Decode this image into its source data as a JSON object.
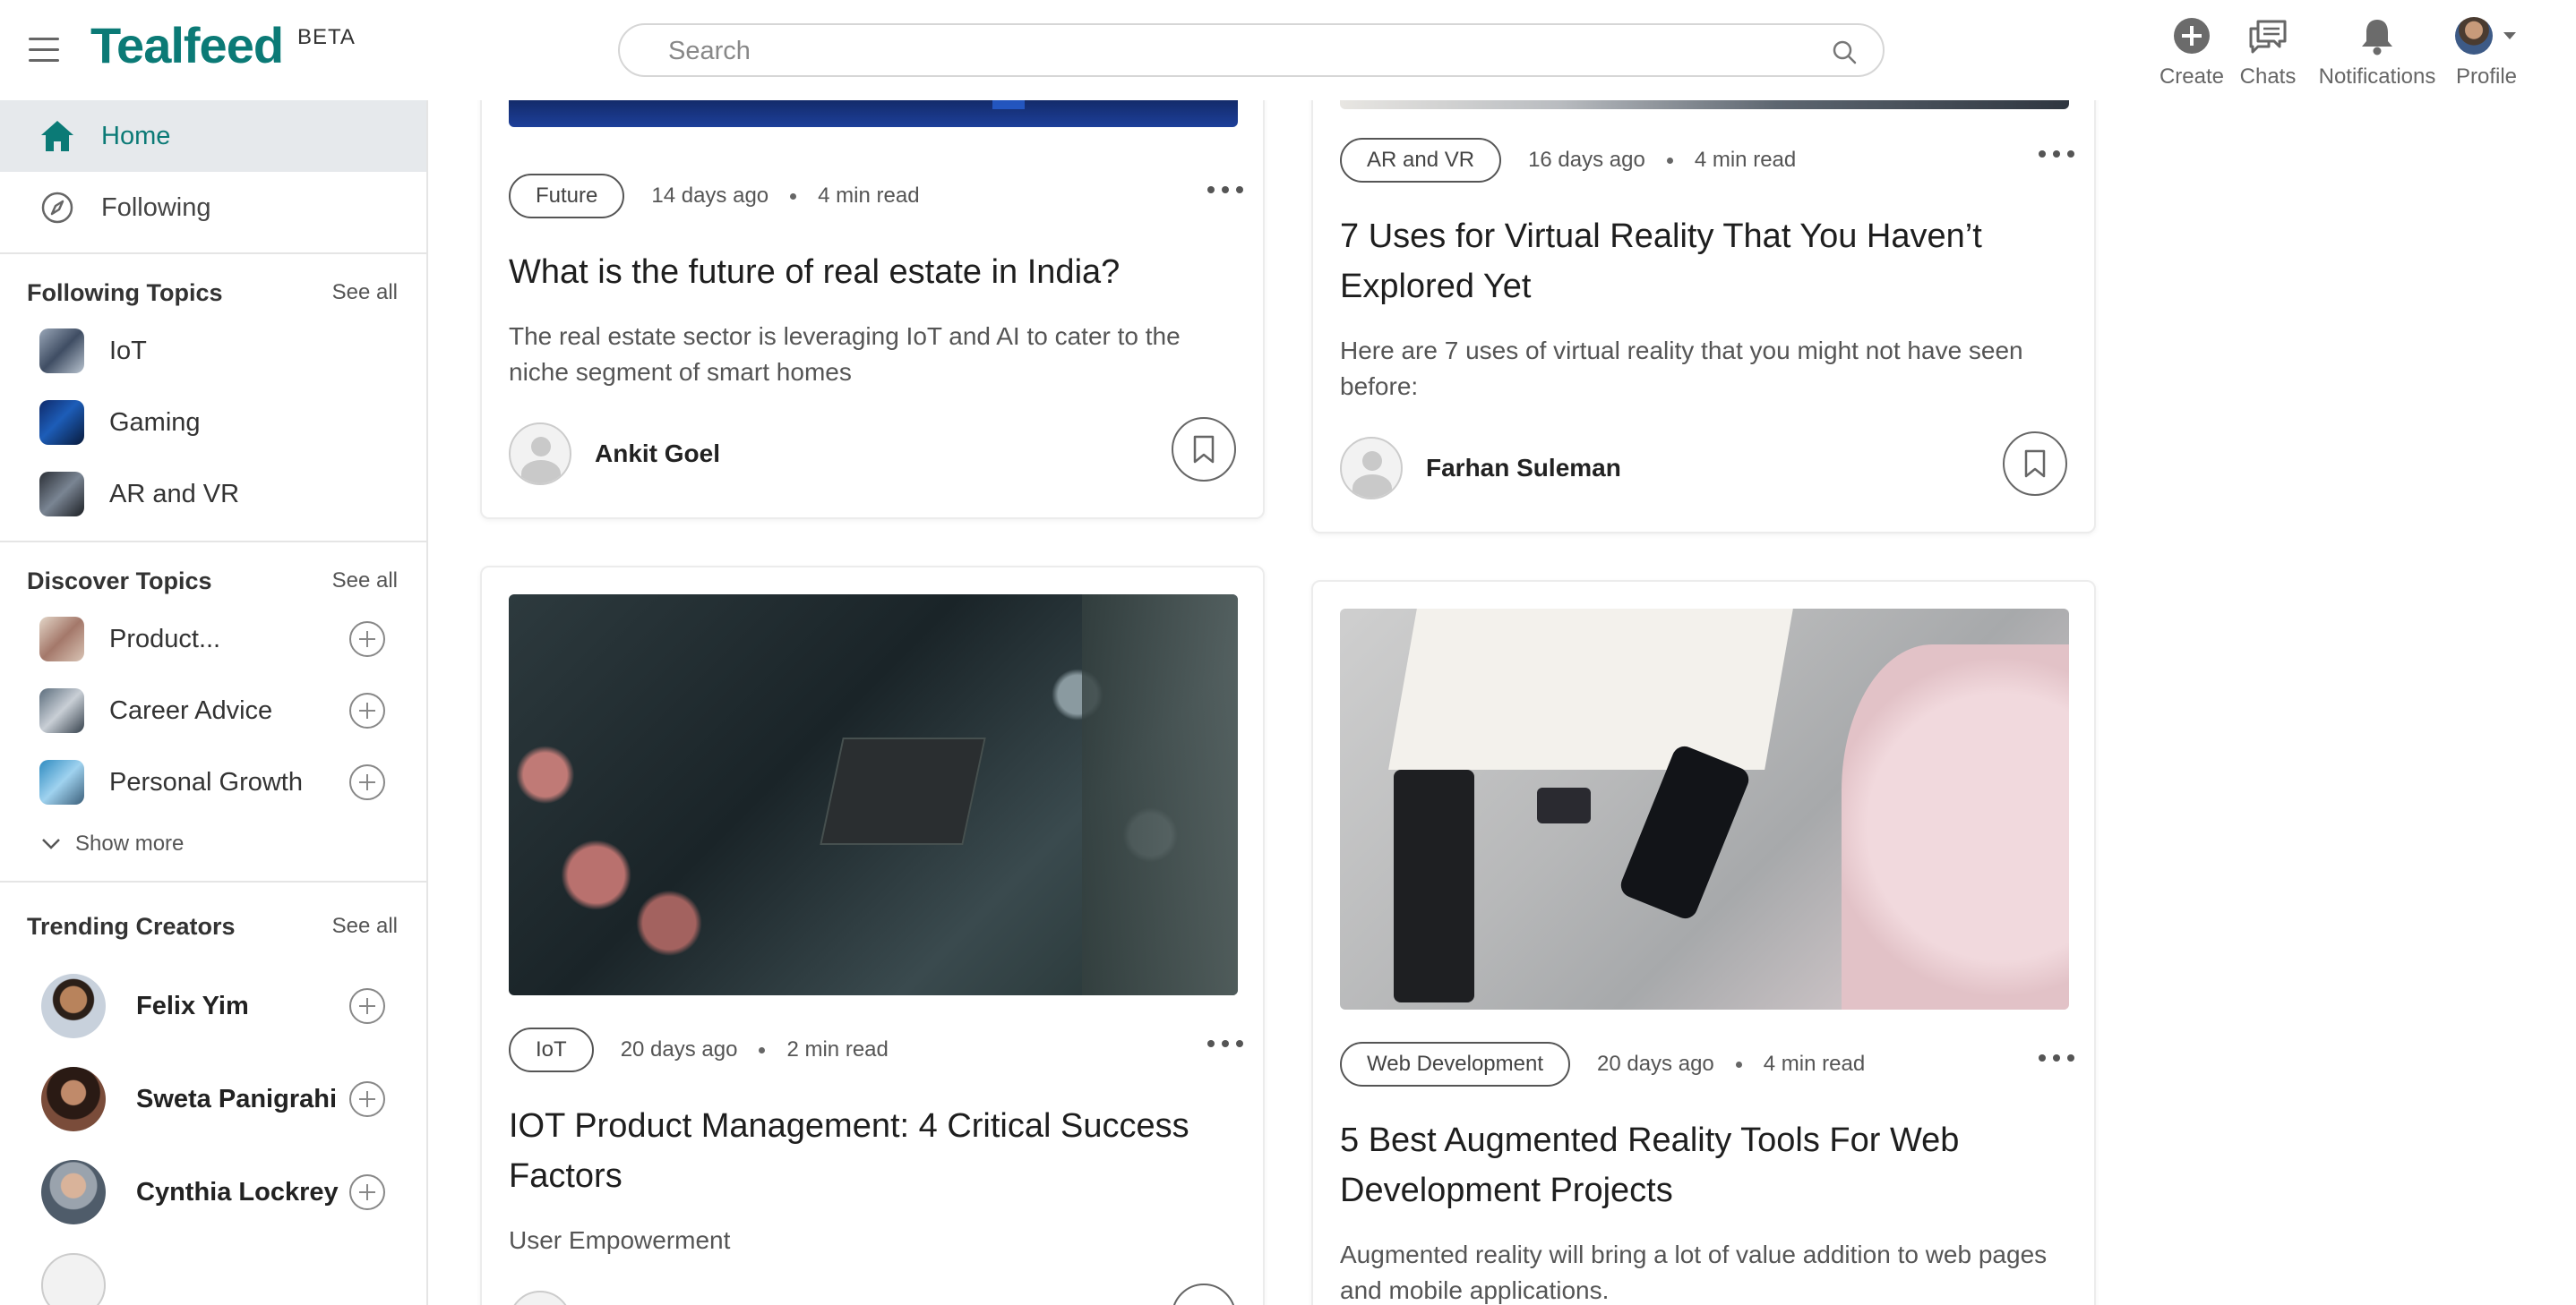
{
  "header": {
    "logo": "Tealfeed",
    "beta": "BETA",
    "search_placeholder": "Search",
    "actions": [
      {
        "label": "Create",
        "icon": "plus-circle-icon"
      },
      {
        "label": "Chats",
        "icon": "chat-icon"
      },
      {
        "label": "Notifications",
        "icon": "bell-icon"
      },
      {
        "label": "Profile",
        "icon": "avatar"
      }
    ]
  },
  "sidebar": {
    "nav": [
      {
        "label": "Home",
        "icon": "home-icon",
        "active": true
      },
      {
        "label": "Following",
        "icon": "compass-icon",
        "active": false
      }
    ],
    "following_topics": {
      "title": "Following Topics",
      "see_all": "See all",
      "items": [
        "IoT",
        "Gaming",
        "AR and VR"
      ]
    },
    "discover_topics": {
      "title": "Discover Topics",
      "see_all": "See all",
      "items": [
        "Product...",
        "Career Advice",
        "Personal Growth"
      ],
      "show_more": "Show more"
    },
    "trending_creators": {
      "title": "Trending Creators",
      "see_all": "See all",
      "items": [
        "Felix Yim",
        "Sweta Panigrahi",
        "Cynthia Lockrey"
      ]
    }
  },
  "feed": {
    "cards": [
      {
        "tag": "Future",
        "age": "14 days ago",
        "read": "4 min read",
        "title": "What is the future of real estate in India?",
        "desc": "The real estate sector is leveraging IoT and AI to cater to the niche segment of smart homes",
        "author": "Ankit Goel"
      },
      {
        "tag": "AR and VR",
        "age": "16 days ago",
        "read": "4 min read",
        "title": "7 Uses for Virtual Reality That You Haven’t Explored Yet",
        "desc": "Here are 7 uses of virtual reality that you might not have seen before:",
        "author": "Farhan Suleman"
      },
      {
        "tag": "IoT",
        "age": "20 days ago",
        "read": "2 min read",
        "title": "IOT Product Management: 4 Critical Success Factors",
        "desc": "User Empowerment",
        "author": ""
      },
      {
        "tag": "Web Development",
        "age": "20 days ago",
        "read": "4 min read",
        "title": "5 Best Augmented Reality Tools For Web Development Projects",
        "desc": "Augmented reality will bring a lot of value addition to web pages and mobile applications.",
        "author": ""
      }
    ]
  },
  "colors": {
    "brand": "#0b7a76",
    "active_bg": "#e6e9ec"
  }
}
